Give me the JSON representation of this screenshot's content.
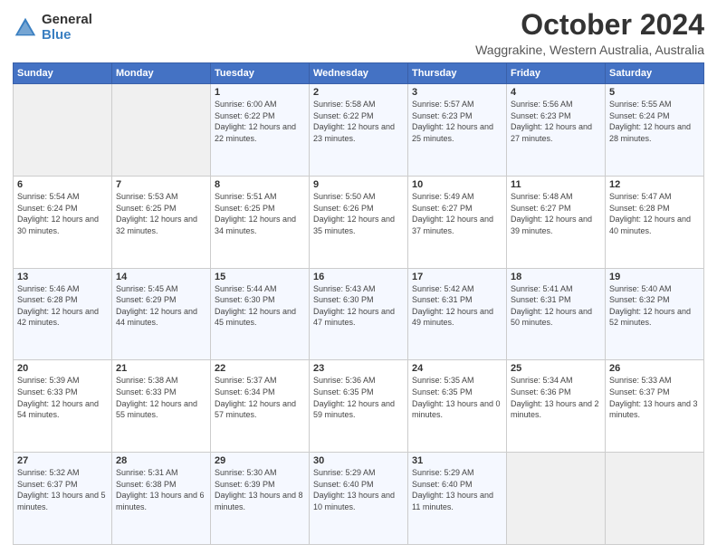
{
  "logo": {
    "general": "General",
    "blue": "Blue"
  },
  "header": {
    "title": "October 2024",
    "subtitle": "Waggrakine, Western Australia, Australia"
  },
  "weekdays": [
    "Sunday",
    "Monday",
    "Tuesday",
    "Wednesday",
    "Thursday",
    "Friday",
    "Saturday"
  ],
  "weeks": [
    [
      {
        "day": "",
        "content": ""
      },
      {
        "day": "",
        "content": ""
      },
      {
        "day": "1",
        "sunrise": "6:00 AM",
        "sunset": "6:22 PM",
        "daylight": "12 hours and 22 minutes."
      },
      {
        "day": "2",
        "sunrise": "5:58 AM",
        "sunset": "6:22 PM",
        "daylight": "12 hours and 23 minutes."
      },
      {
        "day": "3",
        "sunrise": "5:57 AM",
        "sunset": "6:23 PM",
        "daylight": "12 hours and 25 minutes."
      },
      {
        "day": "4",
        "sunrise": "5:56 AM",
        "sunset": "6:23 PM",
        "daylight": "12 hours and 27 minutes."
      },
      {
        "day": "5",
        "sunrise": "5:55 AM",
        "sunset": "6:24 PM",
        "daylight": "12 hours and 28 minutes."
      }
    ],
    [
      {
        "day": "6",
        "sunrise": "5:54 AM",
        "sunset": "6:24 PM",
        "daylight": "12 hours and 30 minutes."
      },
      {
        "day": "7",
        "sunrise": "5:53 AM",
        "sunset": "6:25 PM",
        "daylight": "12 hours and 32 minutes."
      },
      {
        "day": "8",
        "sunrise": "5:51 AM",
        "sunset": "6:25 PM",
        "daylight": "12 hours and 34 minutes."
      },
      {
        "day": "9",
        "sunrise": "5:50 AM",
        "sunset": "6:26 PM",
        "daylight": "12 hours and 35 minutes."
      },
      {
        "day": "10",
        "sunrise": "5:49 AM",
        "sunset": "6:27 PM",
        "daylight": "12 hours and 37 minutes."
      },
      {
        "day": "11",
        "sunrise": "5:48 AM",
        "sunset": "6:27 PM",
        "daylight": "12 hours and 39 minutes."
      },
      {
        "day": "12",
        "sunrise": "5:47 AM",
        "sunset": "6:28 PM",
        "daylight": "12 hours and 40 minutes."
      }
    ],
    [
      {
        "day": "13",
        "sunrise": "5:46 AM",
        "sunset": "6:28 PM",
        "daylight": "12 hours and 42 minutes."
      },
      {
        "day": "14",
        "sunrise": "5:45 AM",
        "sunset": "6:29 PM",
        "daylight": "12 hours and 44 minutes."
      },
      {
        "day": "15",
        "sunrise": "5:44 AM",
        "sunset": "6:30 PM",
        "daylight": "12 hours and 45 minutes."
      },
      {
        "day": "16",
        "sunrise": "5:43 AM",
        "sunset": "6:30 PM",
        "daylight": "12 hours and 47 minutes."
      },
      {
        "day": "17",
        "sunrise": "5:42 AM",
        "sunset": "6:31 PM",
        "daylight": "12 hours and 49 minutes."
      },
      {
        "day": "18",
        "sunrise": "5:41 AM",
        "sunset": "6:31 PM",
        "daylight": "12 hours and 50 minutes."
      },
      {
        "day": "19",
        "sunrise": "5:40 AM",
        "sunset": "6:32 PM",
        "daylight": "12 hours and 52 minutes."
      }
    ],
    [
      {
        "day": "20",
        "sunrise": "5:39 AM",
        "sunset": "6:33 PM",
        "daylight": "12 hours and 54 minutes."
      },
      {
        "day": "21",
        "sunrise": "5:38 AM",
        "sunset": "6:33 PM",
        "daylight": "12 hours and 55 minutes."
      },
      {
        "day": "22",
        "sunrise": "5:37 AM",
        "sunset": "6:34 PM",
        "daylight": "12 hours and 57 minutes."
      },
      {
        "day": "23",
        "sunrise": "5:36 AM",
        "sunset": "6:35 PM",
        "daylight": "12 hours and 59 minutes."
      },
      {
        "day": "24",
        "sunrise": "5:35 AM",
        "sunset": "6:35 PM",
        "daylight": "13 hours and 0 minutes."
      },
      {
        "day": "25",
        "sunrise": "5:34 AM",
        "sunset": "6:36 PM",
        "daylight": "13 hours and 2 minutes."
      },
      {
        "day": "26",
        "sunrise": "5:33 AM",
        "sunset": "6:37 PM",
        "daylight": "13 hours and 3 minutes."
      }
    ],
    [
      {
        "day": "27",
        "sunrise": "5:32 AM",
        "sunset": "6:37 PM",
        "daylight": "13 hours and 5 minutes."
      },
      {
        "day": "28",
        "sunrise": "5:31 AM",
        "sunset": "6:38 PM",
        "daylight": "13 hours and 6 minutes."
      },
      {
        "day": "29",
        "sunrise": "5:30 AM",
        "sunset": "6:39 PM",
        "daylight": "13 hours and 8 minutes."
      },
      {
        "day": "30",
        "sunrise": "5:29 AM",
        "sunset": "6:40 PM",
        "daylight": "13 hours and 10 minutes."
      },
      {
        "day": "31",
        "sunrise": "5:29 AM",
        "sunset": "6:40 PM",
        "daylight": "13 hours and 11 minutes."
      },
      {
        "day": "",
        "content": ""
      },
      {
        "day": "",
        "content": ""
      }
    ]
  ]
}
